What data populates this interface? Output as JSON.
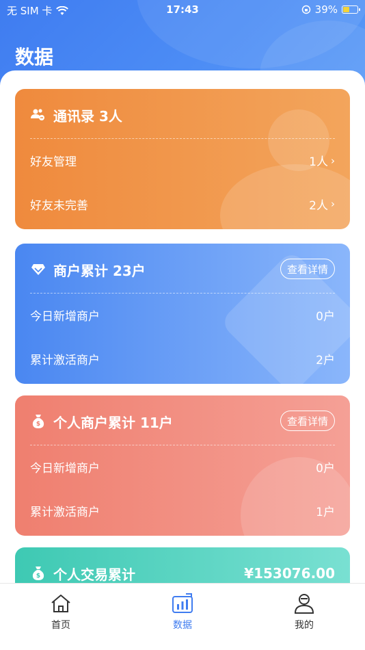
{
  "status_bar": {
    "carrier": "无 SIM 卡",
    "time": "17:43",
    "battery": "39%",
    "battery_level": 0.39
  },
  "page": {
    "title": "数据"
  },
  "cards": {
    "contacts": {
      "title": "通讯录 3人",
      "icon": "contacts-icon",
      "color": "#ef8a3d",
      "rows": [
        {
          "label": "好友管理",
          "value": "1人"
        },
        {
          "label": "好友未完善",
          "value": "2人"
        }
      ]
    },
    "merchants": {
      "title": "商户累计 23户",
      "icon": "diamond-icon",
      "color": "#4a87f1",
      "detail_label": "查看详情",
      "rows": [
        {
          "label": "今日新增商户",
          "value": "0户"
        },
        {
          "label": "累计激活商户",
          "value": "2户"
        }
      ]
    },
    "personal_merchants": {
      "title": "个人商户累计 11户",
      "icon": "money-bag-icon",
      "color": "#ef7f6f",
      "detail_label": "查看详情",
      "rows": [
        {
          "label": "今日新增商户",
          "value": "0户"
        },
        {
          "label": "累计激活商户",
          "value": "1户"
        }
      ]
    },
    "transactions": {
      "title": "个人交易累计",
      "icon": "money-bag-icon",
      "color": "#3ec9b3",
      "amount": "¥153076.00"
    }
  },
  "tabbar": {
    "items": [
      {
        "label": "首页",
        "icon": "home-icon",
        "active": false
      },
      {
        "label": "数据",
        "icon": "chart-icon",
        "active": true
      },
      {
        "label": "我的",
        "icon": "profile-icon",
        "active": false
      }
    ],
    "accent": "#3f7cf0"
  }
}
